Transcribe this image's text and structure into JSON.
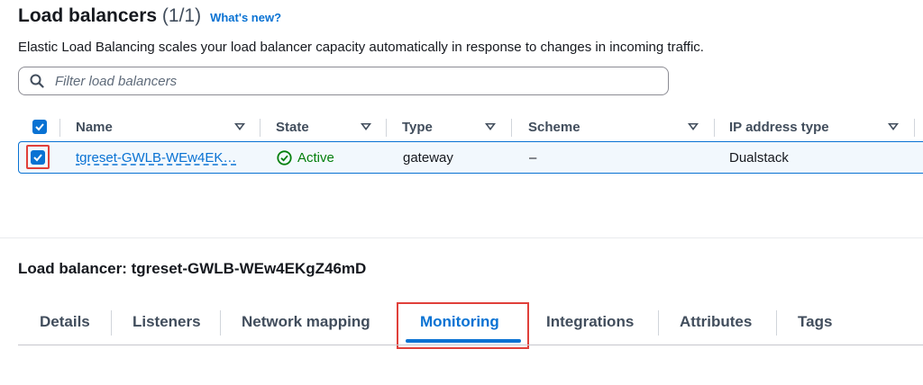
{
  "header": {
    "title": "Load balancers",
    "count": "(1/1)",
    "whats_new": "What's new?",
    "description": "Elastic Load Balancing scales your load balancer capacity automatically in response to changes in incoming traffic."
  },
  "search": {
    "placeholder": "Filter load balancers",
    "value": ""
  },
  "table": {
    "columns": [
      "Name",
      "State",
      "Type",
      "Scheme",
      "IP address type"
    ],
    "rows": [
      {
        "selected": true,
        "name": "tgreset-GWLB-WEw4EK…",
        "state": "Active",
        "type": "gateway",
        "scheme": "–",
        "ip_address_type": "Dualstack"
      }
    ]
  },
  "details": {
    "title": "Load balancer: tgreset-GWLB-WEw4EKgZ46mD",
    "tabs": [
      "Details",
      "Listeners",
      "Network mapping",
      "Monitoring",
      "Integrations",
      "Attributes",
      "Tags"
    ],
    "active_tab": "Monitoring"
  },
  "colors": {
    "accent": "#0972d3",
    "success": "#037f0c",
    "highlight": "#e0403a"
  },
  "icons": {
    "search": "search-icon",
    "sort": "caret-down-icon",
    "status": "check-circle-icon",
    "checkbox": "checkmark-icon"
  }
}
